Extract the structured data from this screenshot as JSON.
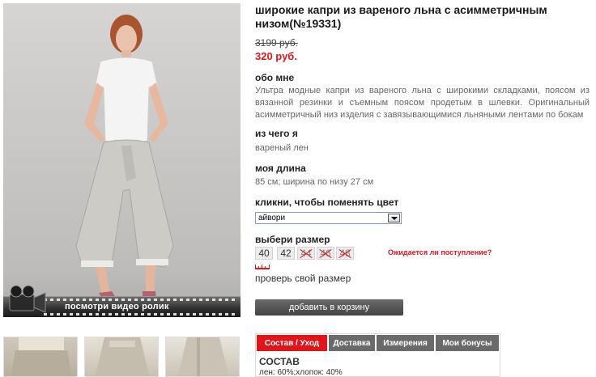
{
  "product": {
    "title": "широкие капри из вареного льна с асимметричным низом(№19331)",
    "old_price": "3199 руб.",
    "new_price": "320 руб."
  },
  "about": {
    "heading": "обо мне",
    "text": "Ультра модные капри из вареного льна с широкими складками, поясом из вязанной резинки и съемным поясом продетым в шлевки. Оригинальный асимметричный низ изделия с завязывающимися льняными лентами по бокам"
  },
  "material": {
    "heading": "из чего я",
    "text": "вареный лен"
  },
  "length": {
    "heading": "моя длина",
    "text": "85 см; ширина по низу 27 см"
  },
  "color": {
    "heading": "кликни, чтобы поменять цвет",
    "selected": "айвори",
    "icon": "chevron-down-icon"
  },
  "sizes": {
    "heading": "выбери размер",
    "items": [
      {
        "label": "40",
        "available": true
      },
      {
        "label": "42",
        "available": true
      },
      {
        "label": "44",
        "available": false
      },
      {
        "label": "46",
        "available": false
      },
      {
        "label": "48",
        "available": false
      }
    ],
    "awaiting_link": "Ожидается ли поступление?",
    "check_size_link": "проверь свой размер",
    "ruler_icon": "ruler-icon"
  },
  "cart": {
    "add_label": "добавить в корзину"
  },
  "video": {
    "label": "посмотри видео ролик",
    "icon": "video-camera-icon"
  },
  "tabs": {
    "items": [
      {
        "label": "Состав / Уход",
        "active": true
      },
      {
        "label": "Доставка",
        "active": false
      },
      {
        "label": "Измерения",
        "active": false
      },
      {
        "label": "Мои бонусы",
        "active": false
      }
    ],
    "content_title": "СОСТАВ",
    "content_text": "лен: 60%;хлопок: 40%"
  },
  "colors": {
    "accent": "#e0141b",
    "button": "#555555",
    "tab_inactive": "#6a6a6a"
  }
}
